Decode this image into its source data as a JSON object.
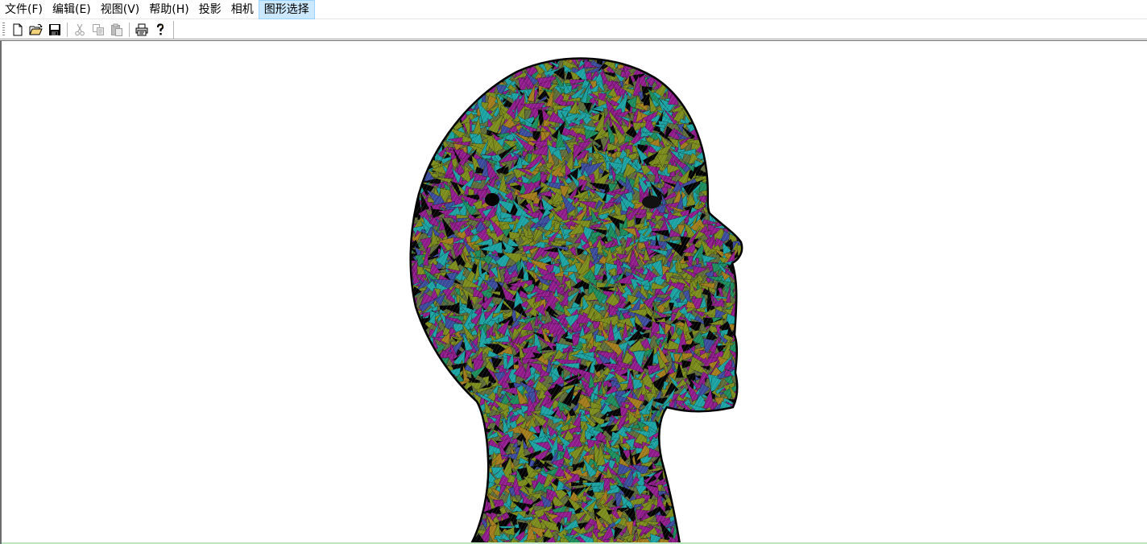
{
  "menubar": {
    "items": [
      {
        "label": "文件(F)"
      },
      {
        "label": "编辑(E)"
      },
      {
        "label": "视图(V)"
      },
      {
        "label": "帮助(H)"
      },
      {
        "label": "投影"
      },
      {
        "label": "相机"
      },
      {
        "label": "图形选择"
      }
    ],
    "active_index": 6
  },
  "toolbar": {
    "buttons": [
      {
        "icon": "new-file-icon",
        "enabled": true
      },
      {
        "icon": "open-folder-icon",
        "enabled": true
      },
      {
        "icon": "save-icon",
        "enabled": true
      },
      {
        "icon": "cut-icon",
        "enabled": false
      },
      {
        "icon": "copy-icon",
        "enabled": false
      },
      {
        "icon": "paste-icon",
        "enabled": false
      },
      {
        "icon": "print-icon",
        "enabled": true
      },
      {
        "icon": "help-icon",
        "enabled": true
      }
    ]
  },
  "viewport": {
    "content": "3d-mesh-head",
    "palette": [
      "#8e1a8a",
      "#7a8a1a",
      "#1aa0a0",
      "#000000",
      "#3a4a9a",
      "#a07a1a",
      "#1a8a5a"
    ]
  }
}
